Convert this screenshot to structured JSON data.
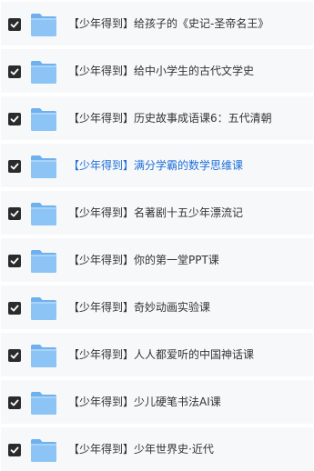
{
  "colors": {
    "row_background": "#f7f8fa",
    "checkbox_fill": "#2b2b2b",
    "folder_blue": "#8cc4f6",
    "text_default": "#333333",
    "text_highlight": "#1f6fd8"
  },
  "items": [
    {
      "label": "【少年得到】给孩子的《史记-圣帝名王》",
      "checked": true,
      "highlight": false,
      "icon": "folder-icon"
    },
    {
      "label": "【少年得到】给中小学生的古代文学史",
      "checked": true,
      "highlight": false,
      "icon": "folder-icon"
    },
    {
      "label": "【少年得到】历史故事成语课6：五代清朝",
      "checked": true,
      "highlight": false,
      "icon": "folder-icon"
    },
    {
      "label": "【少年得到】满分学霸的数学思维课",
      "checked": true,
      "highlight": true,
      "icon": "folder-icon"
    },
    {
      "label": "【少年得到】名著剧十五少年漂流记",
      "checked": true,
      "highlight": false,
      "icon": "folder-icon"
    },
    {
      "label": "【少年得到】你的第一堂PPT课",
      "checked": true,
      "highlight": false,
      "icon": "folder-icon"
    },
    {
      "label": "【少年得到】奇妙动画实验课",
      "checked": true,
      "highlight": false,
      "icon": "folder-icon"
    },
    {
      "label": "【少年得到】人人都爱听的中国神话课",
      "checked": true,
      "highlight": false,
      "icon": "folder-icon"
    },
    {
      "label": "【少年得到】少儿硬笔书法AI课",
      "checked": true,
      "highlight": false,
      "icon": "folder-icon"
    },
    {
      "label": "【少年得到】少年世界史·近代",
      "checked": true,
      "highlight": false,
      "icon": "folder-icon"
    }
  ]
}
